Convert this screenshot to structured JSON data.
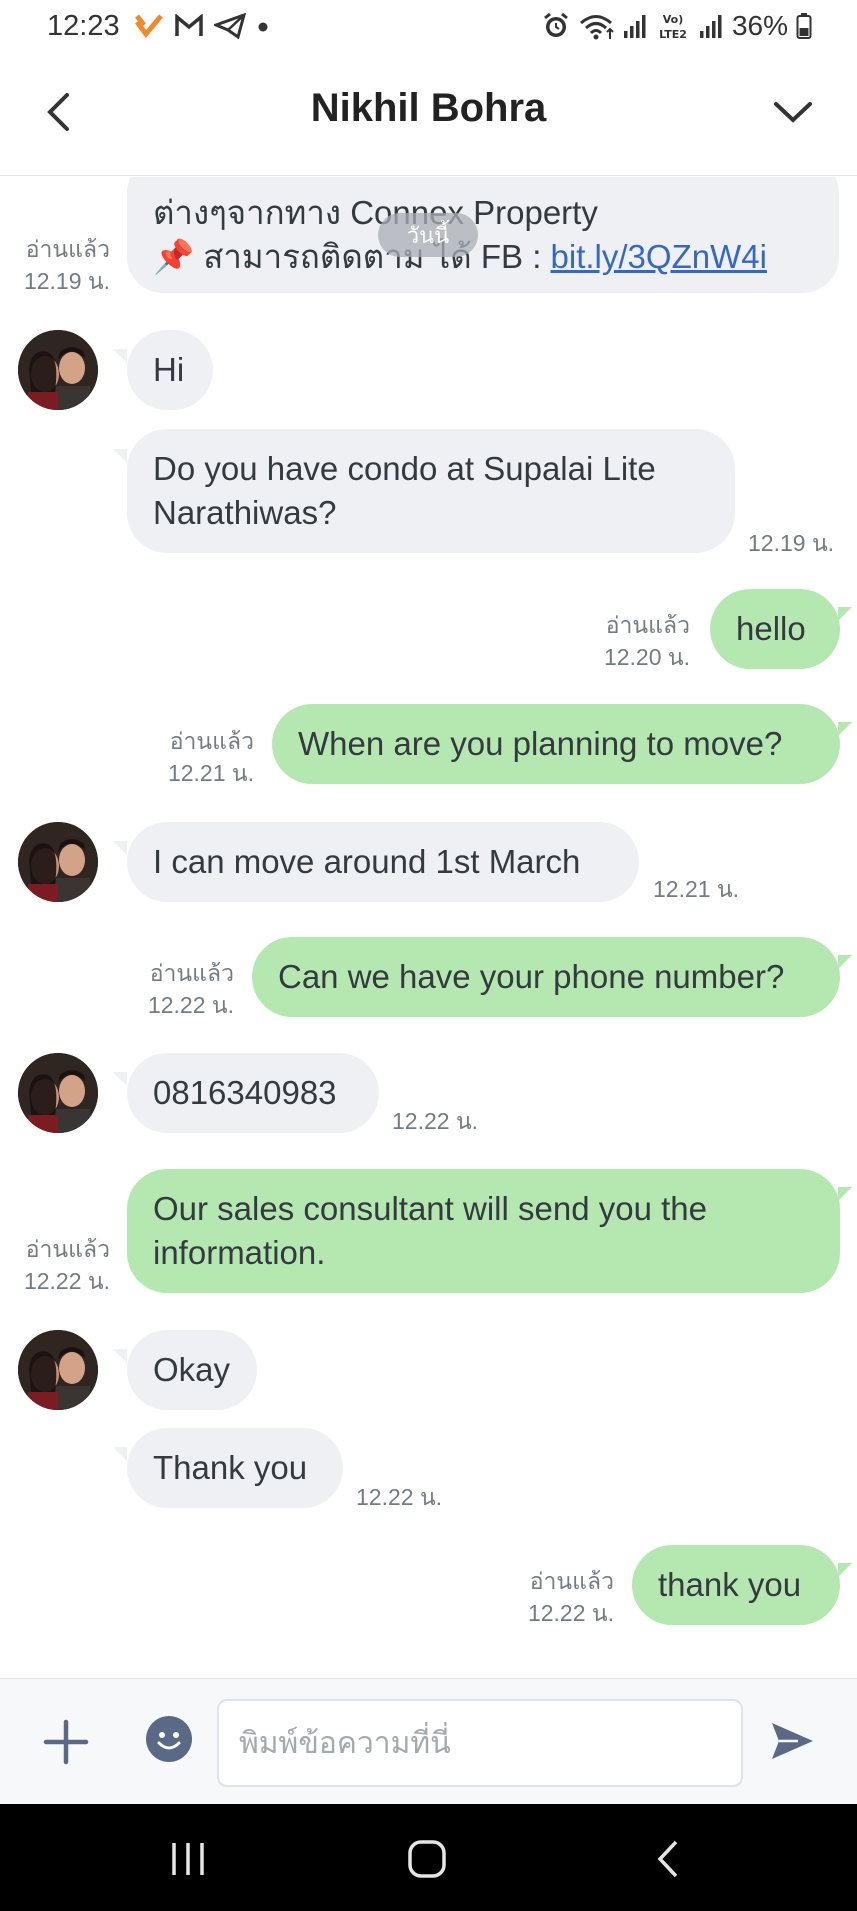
{
  "status_bar": {
    "time": "12:23",
    "battery_percent": "36%",
    "left_icons": [
      "vpn-icon",
      "gmail-icon",
      "telegram-icon",
      "dot-icon"
    ],
    "right_icons": [
      "alarm-icon",
      "wifi-icon",
      "signal-icon",
      "volte-icon",
      "signal-icon",
      "battery-icon"
    ]
  },
  "header": {
    "title": "Nikhil Bohra",
    "back_icon": "chevron-left-icon",
    "dropdown_icon": "chevron-down-icon"
  },
  "date_chip": "วันนี้",
  "messages": [
    {
      "direction": "in",
      "line1": "ต่างๆจากทาง Connex Property",
      "line2_prefix": "📌 สามารถติดตาม ได้ FB : ",
      "link": "bit.ly/3QZnW4i",
      "read_label": "อ่านแล้ว",
      "time": "12.19 น."
    },
    {
      "direction": "in",
      "text": "Hi"
    },
    {
      "direction": "in",
      "text": "Do you have condo at Supalai Lite Narathiwas?",
      "time": "12.19 น."
    },
    {
      "direction": "out",
      "text": "hello",
      "read_label": "อ่านแล้ว",
      "time": "12.20 น."
    },
    {
      "direction": "out",
      "text": "When are you planning to move?",
      "read_label": "อ่านแล้ว",
      "time": "12.21 น."
    },
    {
      "direction": "in",
      "text": "I can move around 1st March",
      "time": "12.21 น."
    },
    {
      "direction": "out",
      "text": "Can we have your phone number?",
      "read_label": "อ่านแล้ว",
      "time": "12.22 น."
    },
    {
      "direction": "in",
      "text": "0816340983",
      "time": "12.22 น."
    },
    {
      "direction": "out",
      "text": "Our sales consultant will send you the information.",
      "read_label": "อ่านแล้ว",
      "time": "12.22 น."
    },
    {
      "direction": "in",
      "text": "Okay"
    },
    {
      "direction": "in",
      "text": "Thank you",
      "time": "12.22 น."
    },
    {
      "direction": "out",
      "text": "thank you",
      "read_label": "อ่านแล้ว",
      "time": "12.22 น."
    }
  ],
  "input_bar": {
    "placeholder": "พิมพ์ข้อความที่นี่",
    "plus_icon": "plus-icon",
    "emoji_icon": "emoji-icon",
    "send_icon": "send-icon"
  },
  "nav_bar": {
    "items": [
      "recent-apps-icon",
      "home-icon",
      "back-icon"
    ]
  },
  "colors": {
    "incoming_bubble": "#eef0f3",
    "outgoing_bubble": "#b5e8b0",
    "link": "#3567c4"
  }
}
